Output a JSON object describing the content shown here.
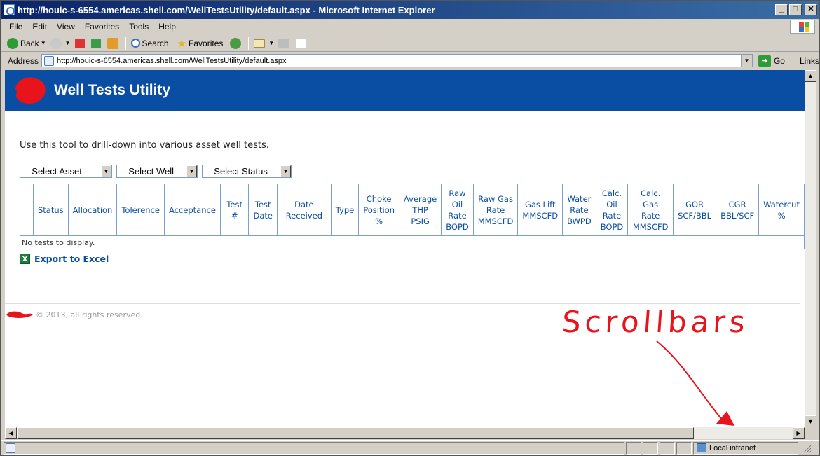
{
  "window": {
    "title": "http://houic-s-6554.americas.shell.com/WellTestsUtility/default.aspx - Microsoft Internet Explorer",
    "minimize": "_",
    "maximize": "□",
    "close": "✕"
  },
  "menu": [
    "File",
    "Edit",
    "View",
    "Favorites",
    "Tools",
    "Help"
  ],
  "toolbar": {
    "back": "Back",
    "search": "Search",
    "favorites": "Favorites"
  },
  "address": {
    "label": "Address",
    "url": "http://houic-s-6554.americas.shell.com/WellTestsUtility/default.aspx",
    "go": "Go",
    "links": "Links"
  },
  "page": {
    "app_title": "Well Tests Utility",
    "intro": "Use this tool to drill-down into various asset well tests.",
    "filters": {
      "asset": "-- Select Asset --",
      "well": "-- Select Well --",
      "status": "-- Select Status --"
    },
    "grid": {
      "columns": [
        "",
        "Status",
        "Allocation",
        "Tolerence",
        "Acceptance",
        "Test #",
        "Test\nDate",
        "Date Received",
        "Type",
        "Choke\nPosition\n%",
        "Average\nTHP\nPSIG",
        "Raw\nOil\nRate\nBOPD",
        "Raw Gas\nRate\nMMSCFD",
        "Gas Lift\nMMSCFD",
        "Water\nRate\nBWPD",
        "Calc.\nOil\nRate\nBOPD",
        "Calc. Gas\nRate\nMMSCFD",
        "GOR\nSCF/BBL",
        "CGR\nBBL/SCF",
        "Watercut\n%"
      ],
      "empty_message": "No tests to display."
    },
    "export": "Export to Excel",
    "footer": "© 2013, all rights reserved."
  },
  "annotation": {
    "text": "Scrollbars",
    "color": "#e8131b"
  },
  "statusbar": {
    "zone": "Local intranet"
  },
  "colors": {
    "banner": "#0a4ea3",
    "grid_text": "#0a4ea3",
    "title_bar_start": "#0a246a",
    "title_bar_end": "#3a6ea5"
  }
}
